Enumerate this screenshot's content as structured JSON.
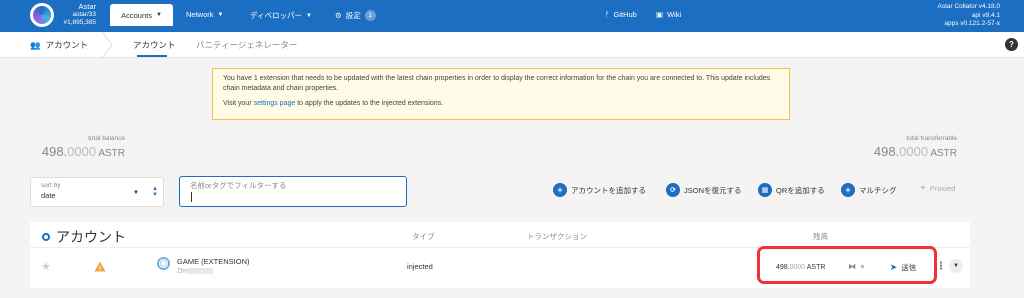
{
  "topbar": {
    "chain_name": "Astar",
    "chain_sub": "astar/33",
    "block": "#1,895,385",
    "accounts_label": "Accounts",
    "network_label": "Network",
    "developer_label": "ディベロッパー",
    "settings_label": "設定",
    "settings_badge": "1",
    "github_label": "GitHub",
    "wiki_label": "Wiki",
    "version_line1": "Astar Collator v4.18.0",
    "version_line2": "api v9.4.1",
    "version_line3": "apps v0.121.2-57-x"
  },
  "tabbar": {
    "section_label": "アカウント",
    "tabs": [
      {
        "label": "アカウント",
        "active": true
      },
      {
        "label": "バニティージェネレーター",
        "active": false
      }
    ],
    "help": "?"
  },
  "warning": {
    "text1": "You have 1 extension that needs to be updated with the latest chain properties in order to display the correct information for the chain you are connected to. This update includes chain metadata and chain properties.",
    "text2_before": "Visit your ",
    "text2_link": "settings page",
    "text2_after": " to apply the updates to the injected extensions."
  },
  "balances": {
    "total_label": "total balance",
    "total_int": "498.",
    "total_dec": "0000",
    "total_unit": " ASTR",
    "transferable_label": "total transferrable",
    "transferable_int": "498.",
    "transferable_dec": "0000",
    "transferable_unit": " ASTR"
  },
  "controls": {
    "sort_label": "sort by",
    "sort_value": "date",
    "filter_placeholder": "名前orタグでフィルターする",
    "add_account": "アカウントを追加する",
    "restore_json": "JSONを復元する",
    "add_qr": "QRを追加する",
    "multisig": "マルチシグ",
    "proxied": "Proxied"
  },
  "table": {
    "title": "アカウント",
    "col_type": "タイプ",
    "col_transactions": "トランザクション",
    "col_balance": "残高",
    "rows": [
      {
        "name": "GAME (EXTENSION)",
        "address_prefix": "Zbs",
        "type": "injected",
        "balance_int": "498.",
        "balance_dec": "0000",
        "balance_unit": " ASTR",
        "send_label": "送信"
      }
    ]
  },
  "colors": {
    "accent": "#1b6ec2",
    "highlight": "#f0303d",
    "warning_bg": "#fffbe6",
    "warning_border": "#f0c14b"
  }
}
